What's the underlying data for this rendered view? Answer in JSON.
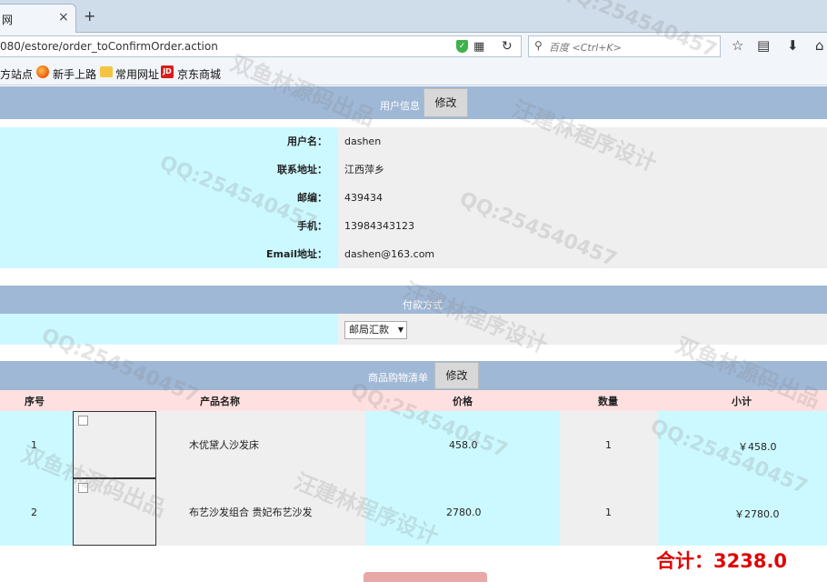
{
  "browser": {
    "tab_title": "网",
    "tab_close": "×",
    "new_tab": "+",
    "url": "080/estore/order_toConfirmOrder.action",
    "search_placeholder": "百度 <Ctrl+K>",
    "bookmarks": [
      "方站点",
      "新手上路",
      "常用网址",
      "京东商城"
    ],
    "jd_badge": "JD"
  },
  "user_info": {
    "title": "用户信息",
    "edit_label": "修改",
    "fields": [
      {
        "label": "用户名：",
        "value": "dashen"
      },
      {
        "label": "联系地址：",
        "value": "江西萍乡"
      },
      {
        "label": "邮编：",
        "value": "439434"
      },
      {
        "label": "手机：",
        "value": "13984343123"
      },
      {
        "label": "Email地址：",
        "value": "dashen@163.com"
      }
    ]
  },
  "payment": {
    "title": "付款方式",
    "selected": "邮局汇款"
  },
  "cart": {
    "title": "商品购物清单",
    "edit_label": "修改",
    "headers": {
      "index": "序号",
      "name": "产品名称",
      "price": "价格",
      "qty": "数量",
      "subtotal": "小计"
    },
    "rows": [
      {
        "index": "1",
        "name": "木优黛人沙发床",
        "price": "458.0",
        "qty": "1",
        "subtotal": "￥458.0"
      },
      {
        "index": "2",
        "name": "布艺沙发组合 贵妃布艺沙发",
        "price": "2780.0",
        "qty": "1",
        "subtotal": "￥2780.0"
      }
    ],
    "total": "合计：3238.0"
  },
  "watermarks": [
    "QQ:254540457",
    "双鱼林源码出品",
    "汪建林程序设计"
  ]
}
